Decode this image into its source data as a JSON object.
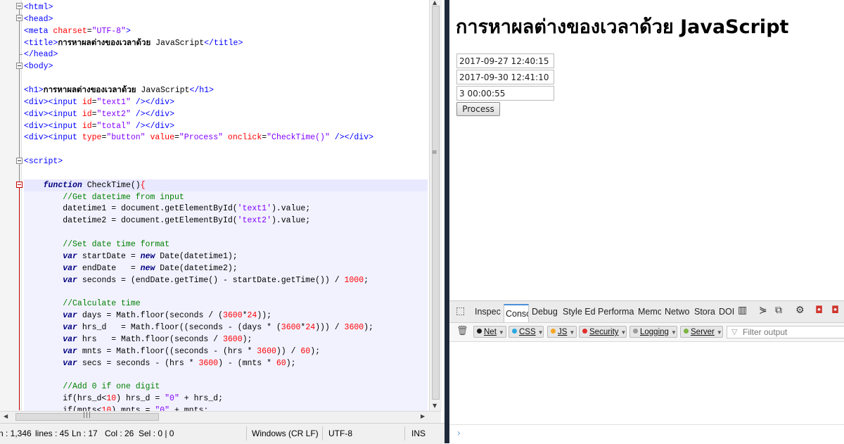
{
  "editor": {
    "code_lines": [
      {
        "html": "<span class='tag'>&lt;html&gt;</span>"
      },
      {
        "html": "<span class='tag'>&lt;head&gt;</span>"
      },
      {
        "html": "<span class='tag'>&lt;meta</span> <span class='attr'>charset</span>=<span class='str'>\"UTF-8\"</span><span class='tag'>&gt;</span>"
      },
      {
        "html": "<span class='tag'>&lt;title&gt;</span><span class='bold'>การหาผลต่างของเวลาด้วย</span> JavaScript<span class='tag'>&lt;/title&gt;</span>"
      },
      {
        "html": "<span class='tag'>&lt;/head&gt;</span>"
      },
      {
        "html": "<span class='tag'>&lt;body&gt;</span>"
      },
      {
        "html": ""
      },
      {
        "html": "<span class='tag'>&lt;h1&gt;</span><span class='bold'>การหาผลต่างของเวลาด้วย</span> JavaScript<span class='tag'>&lt;/h1&gt;</span>"
      },
      {
        "html": "<span class='tag'>&lt;div&gt;&lt;input</span> <span class='attr'>id</span>=<span class='str'>\"text1\"</span> <span class='tag'>/&gt;&lt;/div&gt;</span>"
      },
      {
        "html": "<span class='tag'>&lt;div&gt;&lt;input</span> <span class='attr'>id</span>=<span class='str'>\"text2\"</span> <span class='tag'>/&gt;&lt;/div&gt;</span>"
      },
      {
        "html": "<span class='tag'>&lt;div&gt;&lt;input</span> <span class='attr'>id</span>=<span class='str'>\"total\"</span> <span class='tag'>/&gt;&lt;/div&gt;</span>"
      },
      {
        "html": "<span class='tag'>&lt;div&gt;&lt;input</span> <span class='attr'>type</span>=<span class='str'>\"button\"</span> <span class='attr'>value</span>=<span class='str'>\"Process\"</span> <span class='attr'>onclick</span>=<span class='str'>\"CheckTime()\"</span> <span class='tag'>/&gt;&lt;/div&gt;</span>"
      },
      {
        "html": ""
      },
      {
        "html": "<span class='tag'>&lt;script&gt;</span>"
      },
      {
        "html": ""
      },
      {
        "html": "    <span class='kw'>function</span> CheckTime()<span class='attr'>{</span>"
      },
      {
        "html": "        <span class='cm'>//Get datetime from input</span>"
      },
      {
        "html": "        datetime1 = document.getElementById(<span class='str'>'text1'</span>).value;"
      },
      {
        "html": "        datetime2 = document.getElementById(<span class='str'>'text2'</span>).value;"
      },
      {
        "html": ""
      },
      {
        "html": "        <span class='cm'>//Set date time format</span>"
      },
      {
        "html": "        <span class='kw'>var</span> startDate = <span class='kw'>new</span> Date(datetime1);"
      },
      {
        "html": "        <span class='kw'>var</span> endDate   = <span class='kw'>new</span> Date(datetime2);"
      },
      {
        "html": "        <span class='kw'>var</span> seconds = (endDate.getTime() - startDate.getTime()) / <span class='num'>1000</span>;"
      },
      {
        "html": ""
      },
      {
        "html": "        <span class='cm'>//Calculate time</span>"
      },
      {
        "html": "        <span class='kw'>var</span> days = Math.floor(seconds / (<span class='num'>3600</span>*<span class='num'>24</span>));"
      },
      {
        "html": "        <span class='kw'>var</span> hrs_d   = Math.floor((seconds - (days * (<span class='num'>3600</span>*<span class='num'>24</span>))) / <span class='num'>3600</span>);"
      },
      {
        "html": "        <span class='kw'>var</span> hrs   = Math.floor(seconds / <span class='num'>3600</span>);"
      },
      {
        "html": "        <span class='kw'>var</span> mnts = Math.floor((seconds - (hrs * <span class='num'>3600</span>)) / <span class='num'>60</span>);"
      },
      {
        "html": "        <span class='kw'>var</span> secs = seconds - (hrs * <span class='num'>3600</span>) - (mnts * <span class='num'>60</span>);"
      },
      {
        "html": ""
      },
      {
        "html": "        <span class='cm'>//Add 0 if one digit</span>"
      },
      {
        "html": "        if(hrs_d&lt;<span class='num'>10</span>) hrs_d = <span class='str'>\"0\"</span> + hrs_d;"
      },
      {
        "html": "        if(mnts&lt;<span class='num'>10</span>) mnts = <span class='str'>\"0\"</span> + mnts;"
      }
    ],
    "status": {
      "length": "n : 1,346",
      "lines": "lines : 45",
      "ln": "Ln : 17",
      "col": "Col : 26",
      "sel": "Sel : 0 | 0",
      "eol": "Windows (CR LF)",
      "encoding": "UTF-8",
      "mode": "INS"
    }
  },
  "browser": {
    "heading": "การหาผลต่างของเวลาด้วย JavaScript",
    "text1_value": "2017-09-27 12:40:15",
    "text2_value": "2017-09-30 12:41:10",
    "total_value": "3 00:00:55",
    "button_label": "Process"
  },
  "devtools": {
    "tabs": [
      "Inspec",
      "Conso",
      "Debug",
      "Style Ed",
      "Performa",
      "Memo",
      "Netwo",
      "Stora",
      "DOI"
    ],
    "filters": [
      {
        "label": "Net",
        "color": "#1b1b1b"
      },
      {
        "label": "CSS",
        "color": "#29a9e0"
      },
      {
        "label": "JS",
        "color": "#f5a623"
      },
      {
        "label": "Security",
        "color": "#e02d2d"
      },
      {
        "label": "Logging",
        "color": "#9b9b9b"
      },
      {
        "label": "Server",
        "color": "#7cb342"
      }
    ],
    "filter_placeholder": "Filter output",
    "prompt": "›"
  }
}
